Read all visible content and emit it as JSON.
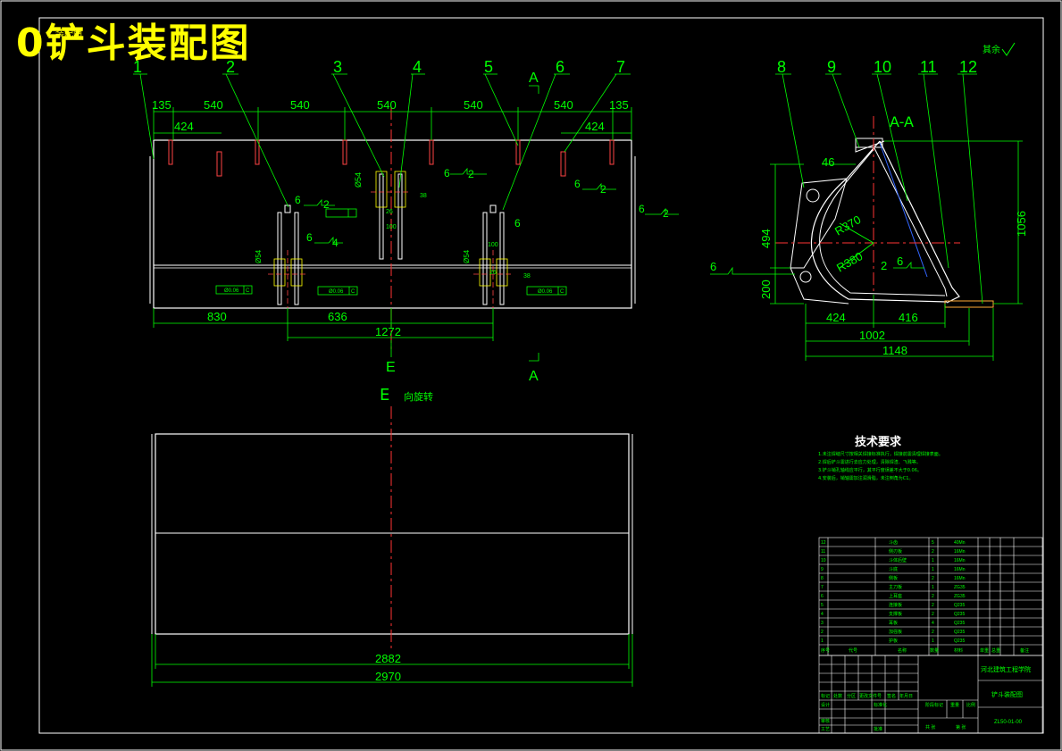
{
  "title": "0铲斗装配图",
  "subtitle": "装配图",
  "tag": "其余",
  "balloons": [
    "1",
    "2",
    "3",
    "4",
    "5",
    "6",
    "7",
    "8",
    "9",
    "10",
    "11",
    "12"
  ],
  "section_marks": {
    "a_top": "A",
    "a_bottom": "A",
    "e_mark": "E",
    "e_view": "E",
    "e_view_text": "向旋转",
    "aa": "A-A"
  },
  "front_dims": {
    "top": [
      "135",
      "540",
      "540",
      "540",
      "540",
      "540",
      "135"
    ],
    "inner": [
      "424",
      "424"
    ],
    "bottom": [
      "830",
      "636",
      "1272"
    ],
    "hole": "Ø54",
    "small": [
      "26",
      "100",
      "26",
      "100",
      "38",
      "38"
    ],
    "tol": [
      "Ø0.06",
      "C",
      "Ø0.06",
      "C",
      "Ø0.06",
      "C"
    ],
    "weld": [
      "6",
      "2",
      "6",
      "2",
      "6",
      "4",
      "6",
      "2",
      "6",
      "2",
      "6"
    ]
  },
  "top_dims": [
    "2882",
    "2970"
  ],
  "side_dims": [
    "46",
    "494",
    "200",
    "1056",
    "424",
    "416",
    "1002",
    "1148",
    "R370",
    "R380"
  ],
  "side_weld": [
    "6",
    "2",
    "6"
  ],
  "tech_req": {
    "title": "技术要求",
    "items": [
      "1.未注焊缝尺寸按相关焊接标准执行，焊接前需清理焊接表面。",
      "2.焊后铲斗需进行去应力处理，清除焊渣、飞溅等。",
      "3.铲斗销孔轴线应平行，其平行度误差不大于0.06。",
      "4.安装后，销轴需加注润滑脂，未注倒角为C1。"
    ]
  },
  "bom_rows": [
    [
      "12",
      "斗齿",
      "5",
      "40Mn"
    ],
    [
      "11",
      "侧刃板",
      "2",
      "16Mn"
    ],
    [
      "10",
      "斗体后壁",
      "1",
      "16Mn"
    ],
    [
      "9",
      "斗底",
      "1",
      "16Mn"
    ],
    [
      "8",
      "侧板",
      "2",
      "16Mn"
    ],
    [
      "7",
      "主刀板",
      "1",
      "ZG35"
    ],
    [
      "6",
      "上耳座",
      "2",
      "ZG35"
    ],
    [
      "5",
      "连接板",
      "2",
      "Q235"
    ],
    [
      "4",
      "支撑板",
      "2",
      "Q235"
    ],
    [
      "3",
      "耳板",
      "4",
      "Q235"
    ],
    [
      "2",
      "加强板",
      "2",
      "Q235"
    ],
    [
      "1",
      "护板",
      "1",
      "Q235"
    ]
  ],
  "bom_header": [
    "序号",
    "代号",
    "名称",
    "数量",
    "材料",
    "单重",
    "总重",
    "备注"
  ],
  "title_block": {
    "school": "河北建筑工程学院",
    "drawing": "铲斗装配图",
    "code": "ZL50-01-00",
    "labels": [
      "标记",
      "处数",
      "分区",
      "更改文件号",
      "签名",
      "年月日",
      "设计",
      "标准化",
      "阶段标记",
      "重量",
      "比例",
      "审核",
      "工艺",
      "批准",
      "共 张",
      "第 张"
    ]
  }
}
